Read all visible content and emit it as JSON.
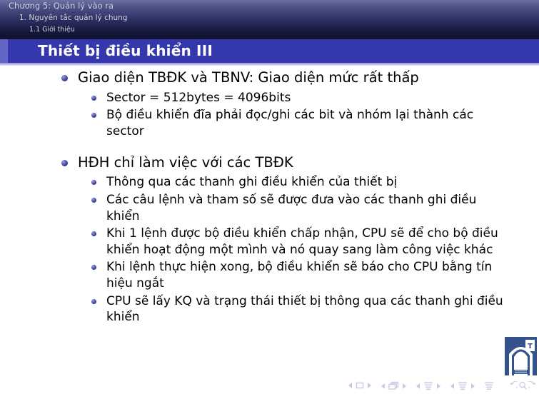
{
  "header": {
    "breadcrumb": {
      "chapter": "Chương 5: Quản lý vào ra",
      "section": "1. Nguyên tắc quản lý chung",
      "subsection": "1.1 Giới thiệu"
    },
    "colors": {
      "gradient_top": "#6b6fa0",
      "gradient_bottom": "#101030"
    }
  },
  "title_bar": {
    "title": "Thiết bị điều khiển III",
    "background": "#3538ad",
    "left_band": "#6366c4"
  },
  "content": {
    "bullets": [
      {
        "text": "Giao diện TBĐK và TBNV: Giao diện mức rất thấp",
        "sub": [
          "Sector = 512bytes = 4096bits",
          "Bộ điều khiển đĩa phải đọc/ghi các bit và nhóm lại thành các sector"
        ]
      },
      {
        "text": "HĐH chỉ làm việc với các TBĐK",
        "sub": [
          "Thông qua các thanh ghi điều khiển của thiết bị",
          "Các câu lệnh và tham số sẽ được đưa vào các thanh ghi điều khiển",
          "Khi 1 lệnh được bộ điều khiển chấp nhận, CPU sẽ để cho bộ điều khiển hoạt động một mình và nó quay sang làm công việc khác",
          "Khi lệnh thực hiện xong, bộ điều khiển sẽ báo cho CPU bằng tín hiệu ngắt",
          "CPU sẽ lấy KQ và trạng thái thiết bị thông qua các thanh ghi điều khiển"
        ]
      }
    ],
    "bullet_color": "#2e2f7e"
  },
  "logo": {
    "name": "institution-arch-logo",
    "color": "#34538c"
  },
  "navbar": {
    "color": "#c9cae4",
    "groups": [
      {
        "name": "slide-nav",
        "icon": "square-frame-icon"
      },
      {
        "name": "frame-nav",
        "icon": "stacked-frames-icon"
      },
      {
        "name": "subsection-nav",
        "icon": "lines-small-icon"
      },
      {
        "name": "section-nav",
        "icon": "lines-medium-icon"
      },
      {
        "name": "presentation-nav",
        "icon": "lines-large-icon"
      }
    ],
    "controls": [
      {
        "name": "back-button",
        "icon": "undo-arrow-icon"
      },
      {
        "name": "search-button",
        "icon": "magnifier-icon"
      },
      {
        "name": "forward-button",
        "icon": "redo-arrow-icon"
      }
    ]
  }
}
